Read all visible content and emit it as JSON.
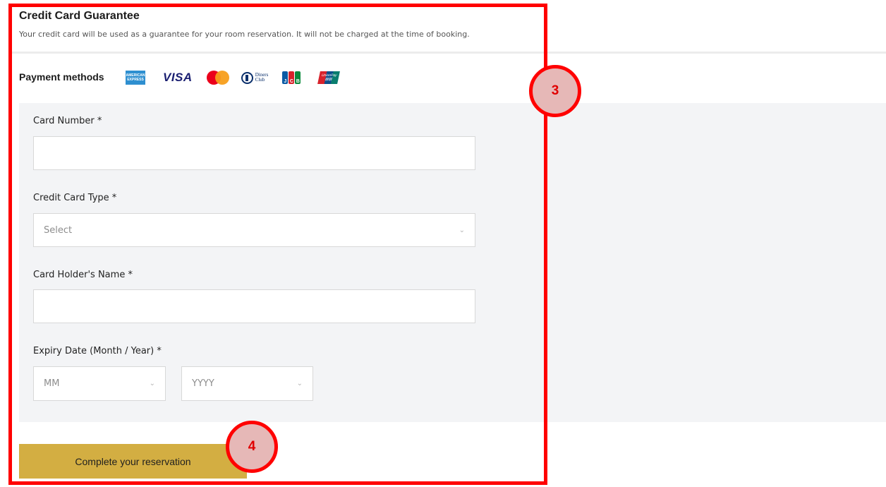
{
  "section": {
    "title": "Credit Card Guarantee",
    "description": "Your credit card will be used as a guarantee for your room reservation. It will not be charged at the time of booking."
  },
  "payment_methods": {
    "label": "Payment methods",
    "logos": [
      {
        "name": "amex-icon",
        "text": "AMERICAN EXPRESS"
      },
      {
        "name": "visa-icon",
        "text": "VISA"
      },
      {
        "name": "mastercard-icon",
        "text": ""
      },
      {
        "name": "diners-club-icon",
        "text": "Diners Club"
      },
      {
        "name": "jcb-icon",
        "text": "JCB"
      },
      {
        "name": "unionpay-icon",
        "text": "UnionPay"
      }
    ]
  },
  "form": {
    "card_number": {
      "label": "Card Number *",
      "value": "",
      "placeholder": ""
    },
    "card_type": {
      "label": "Credit Card Type *",
      "value": "Select"
    },
    "holder_name": {
      "label": "Card Holder's Name *",
      "value": "",
      "placeholder": ""
    },
    "expiry": {
      "label": "Expiry Date (Month / Year) *",
      "month": "MM",
      "year": "YYYY"
    }
  },
  "submit_label": "Complete your reservation",
  "annotations": {
    "badge_3": "3",
    "badge_4": "4",
    "frame_color": "#ff0000",
    "badge_fill": "#e6b8b7"
  },
  "colors": {
    "button": "#d3ae42",
    "panel": "#f3f4f6"
  }
}
